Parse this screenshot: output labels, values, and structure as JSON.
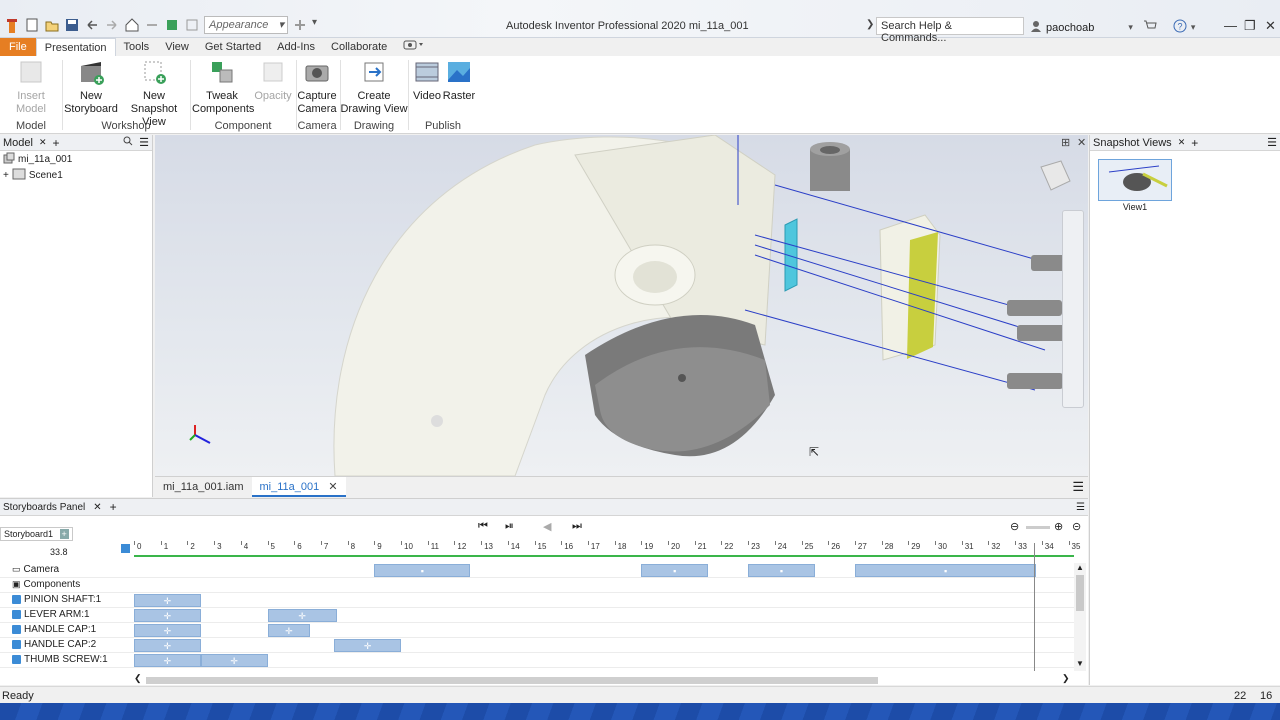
{
  "titlebar": {
    "appearance_placeholder": "Appearance",
    "title": "Autodesk Inventor Professional 2020   mi_11a_001",
    "search_placeholder": "Search Help & Commands...",
    "user": "paochoab"
  },
  "tabs": [
    "File",
    "Presentation",
    "Tools",
    "View",
    "Get Started",
    "Add-Ins",
    "Collaborate"
  ],
  "ribbon": {
    "buttons": {
      "insert_model": "Insert Model",
      "new_storyboard_1": "New",
      "new_storyboard_2": "Storyboard",
      "new_snapshot_1": "New",
      "new_snapshot_2": "Snapshot View",
      "tweak_1": "Tweak",
      "tweak_2": "Components",
      "opacity": "Opacity",
      "capture_1": "Capture",
      "capture_2": "Camera",
      "create_dv_1": "Create",
      "create_dv_2": "Drawing View",
      "video": "Video",
      "raster": "Raster"
    },
    "groups": [
      "Model",
      "Workshop",
      "Component",
      "Camera",
      "Drawing",
      "Publish"
    ]
  },
  "model_panel": {
    "title": "Model",
    "items": [
      "mi_11a_001",
      "Scene1"
    ]
  },
  "doc_tabs": [
    "mi_11a_001.iam",
    "mi_11a_001"
  ],
  "snapshot_panel": {
    "title": "Snapshot Views",
    "views": [
      "View1"
    ]
  },
  "storyboard": {
    "title": "Storyboards Panel",
    "tab": "Storyboard1",
    "current_time": "33.8",
    "ruler_labels": [
      "0",
      "1",
      "2",
      "3",
      "4",
      "5",
      "6",
      "7",
      "8",
      "9",
      "10",
      "11",
      "12",
      "13",
      "14",
      "15",
      "16",
      "17",
      "18",
      "19",
      "20",
      "21",
      "22",
      "23",
      "24",
      "25",
      "26",
      "27",
      "28",
      "29",
      "30",
      "31",
      "32",
      "33",
      "34",
      "35"
    ],
    "rows": [
      {
        "label": "Camera",
        "kind": "camera",
        "bars": [
          [
            9,
            12.6
          ],
          [
            19,
            21.5
          ],
          [
            23,
            25.5
          ],
          [
            27,
            33.8
          ]
        ]
      },
      {
        "label": "Components",
        "kind": "group",
        "bars": []
      },
      {
        "label": "PINION SHAFT:1",
        "kind": "comp",
        "bars": [
          [
            0,
            2.5
          ]
        ]
      },
      {
        "label": "LEVER ARM:1",
        "kind": "comp",
        "bars": [
          [
            0,
            2.5
          ],
          [
            5,
            7.6
          ]
        ]
      },
      {
        "label": "HANDLE CAP:1",
        "kind": "comp",
        "bars": [
          [
            0,
            2.5
          ],
          [
            5,
            6.6
          ]
        ]
      },
      {
        "label": "HANDLE CAP:2",
        "kind": "comp",
        "bars": [
          [
            0,
            2.5
          ],
          [
            7.5,
            10
          ]
        ]
      },
      {
        "label": "THUMB SCREW:1",
        "kind": "comp",
        "bars": [
          [
            0,
            2.5
          ],
          [
            2.5,
            5
          ]
        ]
      }
    ]
  },
  "status": {
    "text": "Ready",
    "num1": "22",
    "num2": "16"
  }
}
